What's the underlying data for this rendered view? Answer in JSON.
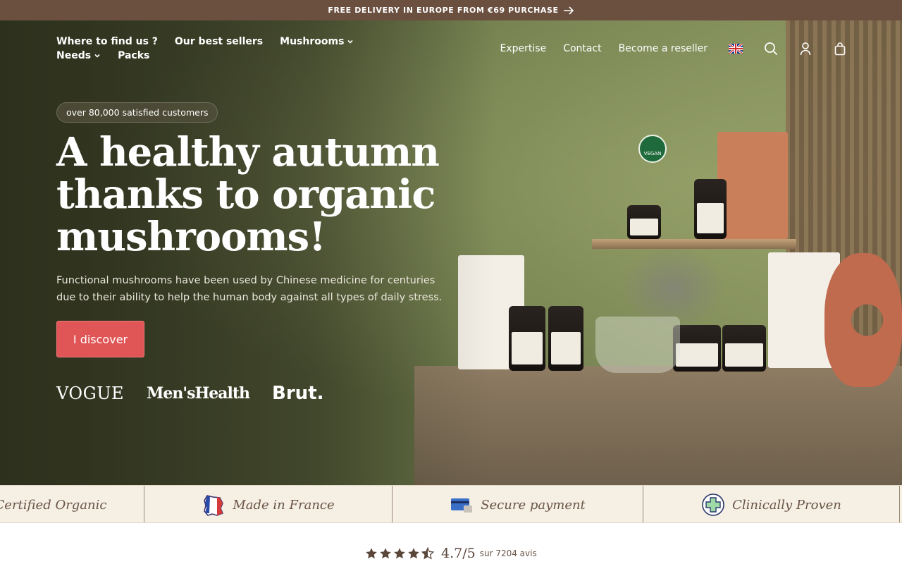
{
  "announcement": {
    "text": "FREE DELIVERY IN EUROPE FROM €69 PURCHASE"
  },
  "nav": {
    "left": [
      {
        "label": "Where to find us ?",
        "has_dropdown": false
      },
      {
        "label": "Our best sellers",
        "has_dropdown": false
      },
      {
        "label": "Mushrooms",
        "has_dropdown": true
      },
      {
        "label": "Needs",
        "has_dropdown": true
      },
      {
        "label": "Packs",
        "has_dropdown": false
      }
    ],
    "right": [
      {
        "label": "Expertise"
      },
      {
        "label": "Contact"
      },
      {
        "label": "Become a reseller"
      }
    ],
    "icons": [
      "uk-flag-icon",
      "search-icon",
      "account-icon",
      "cart-icon"
    ]
  },
  "hero": {
    "badge": "over 80,000 satisfied customers",
    "title": "A healthy autumn thanks to organic mushrooms!",
    "subtitle": "Functional mushrooms have been used by Chinese medicine for centuries due to their ability to help the human body against all types of daily stress.",
    "cta": "I discover",
    "press": [
      "VOGUE",
      "Men'sHealth",
      "Brut."
    ],
    "product_badge": "VEGAN"
  },
  "trust_band": [
    {
      "label": "Certified Organic",
      "icon": "organic-icon"
    },
    {
      "label": "Made in France",
      "icon": "france-map-icon"
    },
    {
      "label": "Secure payment",
      "icon": "credit-card-icon"
    },
    {
      "label": "Clinically Proven",
      "icon": "medical-cross-icon"
    }
  ],
  "rating": {
    "score": "4.7",
    "max": "/5",
    "reviews_text": "sur 7204 avis",
    "stars_filled": 4.5
  },
  "colors": {
    "topbar": "#6b5040",
    "cta": "#e05556",
    "band": "#f5efe4",
    "text_brown": "#6a5546"
  }
}
